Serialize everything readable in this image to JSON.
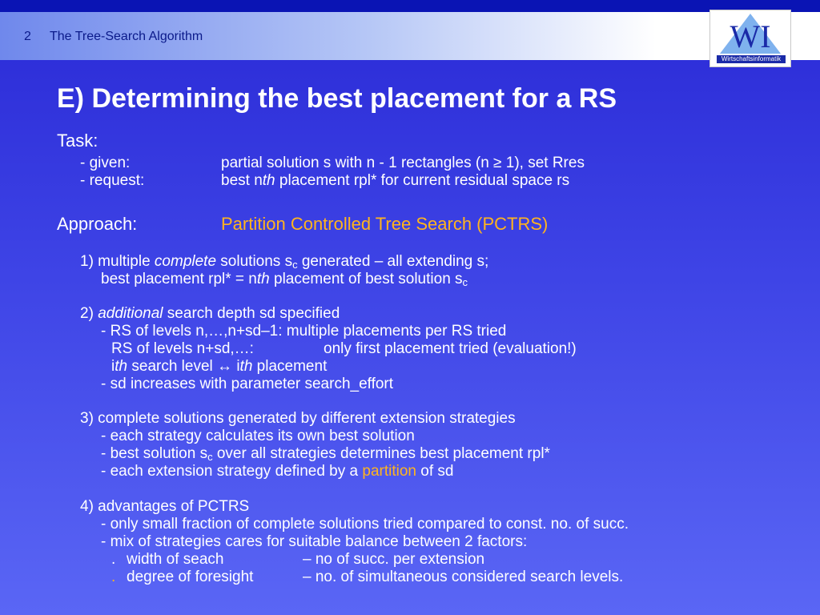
{
  "header": {
    "slide_number": "2",
    "section_title": "The Tree-Search Algorithm",
    "logo_text": "WI",
    "logo_subtext": "Wirtschaftsinformatik"
  },
  "title": "E) Determining the best placement for a RS",
  "task": {
    "heading": "Task:",
    "given_label": "- given:",
    "given_value": "partial solution s with n - 1 rectangles (n ≥ 1), set Rres",
    "request_label": "- request:",
    "request_pre": "best n",
    "request_th": "th",
    "request_post": " placement rpl* for current residual space rs"
  },
  "approach": {
    "label": "Approach:",
    "name": "Partition Controlled Tree Search (PCTRS)"
  },
  "point1": {
    "pre": "1) multiple ",
    "em": "complete",
    "mid": " solutions s",
    "sub": "c",
    "post": " generated – all extending s;",
    "line2_pre": "best placement rpl* = n",
    "line2_th": "th",
    "line2_mid": " placement of best solution s",
    "line2_sub": "c"
  },
  "point2": {
    "pre": "2) ",
    "em": "additional",
    "post": " search depth sd specified",
    "l1": "- RS of levels n,…,n+sd–1: multiple placements per RS tried",
    "l2_left": "RS of levels n+sd,…:",
    "l2_right": "only first placement  tried (evaluation!)",
    "l3_i1": "i",
    "l3_th1": "th",
    "l3_mid": " search level ↔  i",
    "l3_th2": "th",
    "l3_post": " placement",
    "l4": "- sd increases with parameter search_effort"
  },
  "point3": {
    "head": "3) complete solutions generated by different extension strategies",
    "l1": "- each strategy calculates its own best solution",
    "l2_pre": "- best solution s",
    "l2_sub": "c",
    "l2_post": "  over all strategies determines best placement rpl*",
    "l3_pre": "- each extension strategy defined by a ",
    "l3_hl": "partition",
    "l3_post": " of sd"
  },
  "point4": {
    "head": "4) advantages of PCTRS",
    "l1": "- only small fraction of complete solutions tried compared to const. no. of succ.",
    "l2": "- mix of strategies cares for suitable balance between 2 factors:",
    "f1_bullet": ".",
    "f1_name": "width of seach",
    "f1_desc": "–  no of succ. per extension",
    "f2_bullet": ".",
    "f2_name": "degree of foresight",
    "f2_desc": "–  no. of simultaneous considered search levels."
  },
  "colors": {
    "highlight": "#ffb41e",
    "header_text": "#0b1a8a",
    "background_top": "#2a2ad6",
    "background_bottom": "#5a66f5"
  }
}
